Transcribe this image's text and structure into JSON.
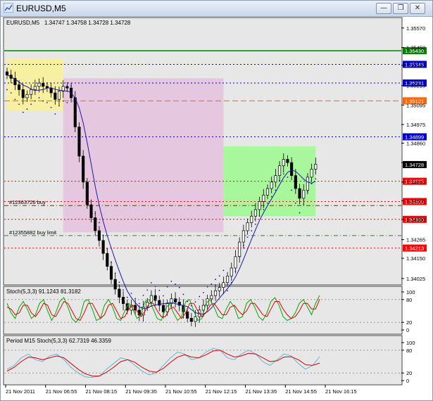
{
  "window": {
    "title": "EURUSD,M5",
    "controls": [
      "minimize",
      "restore",
      "close"
    ]
  },
  "header": {
    "symbol": "EURUSD,M5",
    "ohlc": "1.34747 1.34758 1.34728 1.34728"
  },
  "chart_data": [
    {
      "type": "candlestick",
      "title": "EURUSD,M5",
      "ylim": [
        1.3399,
        1.3563
      ],
      "y_ticks": [
        "1.35570",
        "1.35450",
        "1.35340",
        "1.35215",
        "1.35095",
        "1.34975",
        "1.34860",
        "1.34740",
        "1.34620",
        "1.34505",
        "1.34390",
        "1.34265",
        "1.34150",
        "1.34025"
      ],
      "x_ticks": [
        "21 Nov 2011",
        "21 Nov 06:55",
        "21 Nov 08:15",
        "21 Nov 09:35",
        "21 Nov 10:55",
        "21 Nov 12:15",
        "21 Nov 13:35",
        "21 Nov 14:55",
        "21 Nov 16:15"
      ],
      "current_price": "1.34728",
      "levels": [
        {
          "label": "1.35430",
          "value": 1.3543,
          "color": "#008000",
          "style": "solid"
        },
        {
          "label": "1.35346",
          "value": 1.35346,
          "color": "#0000cc",
          "style": "dotted"
        },
        {
          "label": "1.35231",
          "value": 1.35231,
          "color": "#0000cc",
          "style": "dotted"
        },
        {
          "label": "1.35121",
          "value": 1.35121,
          "color": "#ff6600",
          "style": "dashed"
        },
        {
          "label": "1.34899",
          "value": 1.34899,
          "color": "#0000cc",
          "style": "dotted"
        },
        {
          "label": "1.34625",
          "value": 1.34625,
          "color": "#ff0000",
          "style": "dotted"
        },
        {
          "label": "1.34500",
          "value": 1.345,
          "color": "#ff0000",
          "style": "dotted"
        },
        {
          "label": "1.34390",
          "value": 1.3439,
          "color": "#ff0000",
          "style": "dotted"
        },
        {
          "label": "1.34213",
          "value": 1.34213,
          "color": "#ff0000",
          "style": "dotted"
        }
      ],
      "orders": [
        {
          "label": "#12363726 buy",
          "value": 1.34475
        },
        {
          "label": "#12355882 buy limit",
          "value": 1.3429
        }
      ],
      "zones": [
        {
          "color": "#f7f0a0",
          "y_top": 1.3538,
          "y_bottom": 1.3506,
          "x_start": 0,
          "x_end": 14
        },
        {
          "color": "#e5c7e0",
          "y_top": 1.3526,
          "y_bottom": 1.3431,
          "x_start": 14,
          "x_end": 54
        },
        {
          "color": "#a8f79c",
          "y_top": 1.3484,
          "y_bottom": 1.3441,
          "x_start": 54,
          "x_end": 77
        }
      ],
      "close": [
        1.3528,
        1.3526,
        1.3522,
        1.3519,
        1.3514,
        1.3516,
        1.3519,
        1.3521,
        1.3523,
        1.3521,
        1.352,
        1.3517,
        1.3513,
        1.3518,
        1.3521,
        1.352,
        1.3514,
        1.3496,
        1.3478,
        1.3462,
        1.3448,
        1.344,
        1.3432,
        1.3426,
        1.3418,
        1.341,
        1.3402,
        1.3396,
        1.3391,
        1.3387,
        1.3383,
        1.3386,
        1.3383,
        1.338,
        1.3385,
        1.3388,
        1.3392,
        1.3389,
        1.3386,
        1.3382,
        1.3387,
        1.339,
        1.3388,
        1.3386,
        1.3382,
        1.3378,
        1.3376,
        1.3379,
        1.3383,
        1.3386,
        1.339,
        1.3392,
        1.3395,
        1.3397,
        1.34,
        1.3404,
        1.3409,
        1.3416,
        1.3425,
        1.3432,
        1.3437,
        1.3441,
        1.3445,
        1.345,
        1.3454,
        1.3458,
        1.3462,
        1.3466,
        1.3472,
        1.3476,
        1.3474,
        1.3466,
        1.3458,
        1.3452,
        1.3457,
        1.3465,
        1.347,
        1.3473
      ]
    },
    {
      "type": "line",
      "title": "Stoch(5,3,3) 91.1243 81.3182",
      "ylim": [
        0,
        100
      ],
      "y_ticks": [
        "100",
        "80",
        "20",
        "0"
      ],
      "series": [
        {
          "color": "#00aa00",
          "values": [
            70,
            45,
            30,
            60,
            75,
            55,
            30,
            40,
            70,
            80,
            50,
            25,
            45,
            75,
            85,
            60,
            30,
            20,
            35,
            75,
            80,
            55,
            25,
            30,
            65,
            80,
            60,
            30,
            25,
            50,
            70,
            55,
            30,
            40,
            75,
            80,
            55,
            30,
            25,
            55,
            70,
            45,
            25,
            35,
            75,
            80,
            50,
            25,
            30,
            70,
            80,
            60,
            35,
            30,
            55,
            75,
            60,
            30,
            35,
            70,
            80,
            60,
            35,
            25,
            45,
            75,
            85,
            65,
            35,
            25,
            30,
            45,
            70,
            80,
            60,
            40,
            70,
            91
          ]
        },
        {
          "color": "#dd0000",
          "values": [
            60,
            55,
            40,
            45,
            65,
            65,
            45,
            35,
            50,
            70,
            65,
            40,
            35,
            55,
            75,
            70,
            50,
            30,
            25,
            45,
            70,
            70,
            50,
            30,
            40,
            65,
            70,
            50,
            30,
            35,
            55,
            65,
            50,
            35,
            50,
            70,
            70,
            50,
            35,
            35,
            55,
            60,
            45,
            30,
            45,
            70,
            70,
            50,
            35,
            45,
            65,
            70,
            55,
            40,
            40,
            60,
            65,
            50,
            40,
            50,
            70,
            70,
            55,
            40,
            35,
            55,
            75,
            75,
            55,
            40,
            30,
            35,
            50,
            70,
            70,
            55,
            55,
            81
          ]
        }
      ]
    },
    {
      "type": "line",
      "title": "Period M15 Stoch(5,3,3) 62.7319 46.3359",
      "ylim": [
        0,
        100
      ],
      "y_ticks": [
        "100",
        "80",
        "20",
        "0"
      ],
      "series": [
        {
          "color": "#5fb8d6",
          "values": [
            30,
            40,
            60,
            70,
            55,
            50,
            65,
            70,
            55,
            35,
            20,
            10,
            8,
            12,
            30,
            45,
            60,
            55,
            40,
            25,
            15,
            20,
            40,
            60,
            75,
            70,
            55,
            60,
            75,
            85,
            80,
            60,
            55,
            70,
            80,
            70,
            50,
            40,
            55,
            70,
            65,
            45,
            30,
            40,
            63
          ]
        },
        {
          "color": "#dd0000",
          "values": [
            25,
            35,
            50,
            62,
            60,
            55,
            60,
            65,
            60,
            45,
            30,
            18,
            12,
            12,
            22,
            35,
            50,
            55,
            48,
            35,
            25,
            22,
            32,
            48,
            62,
            68,
            62,
            60,
            68,
            78,
            80,
            70,
            62,
            65,
            72,
            70,
            60,
            50,
            52,
            62,
            63,
            55,
            42,
            40,
            46
          ]
        }
      ]
    }
  ]
}
